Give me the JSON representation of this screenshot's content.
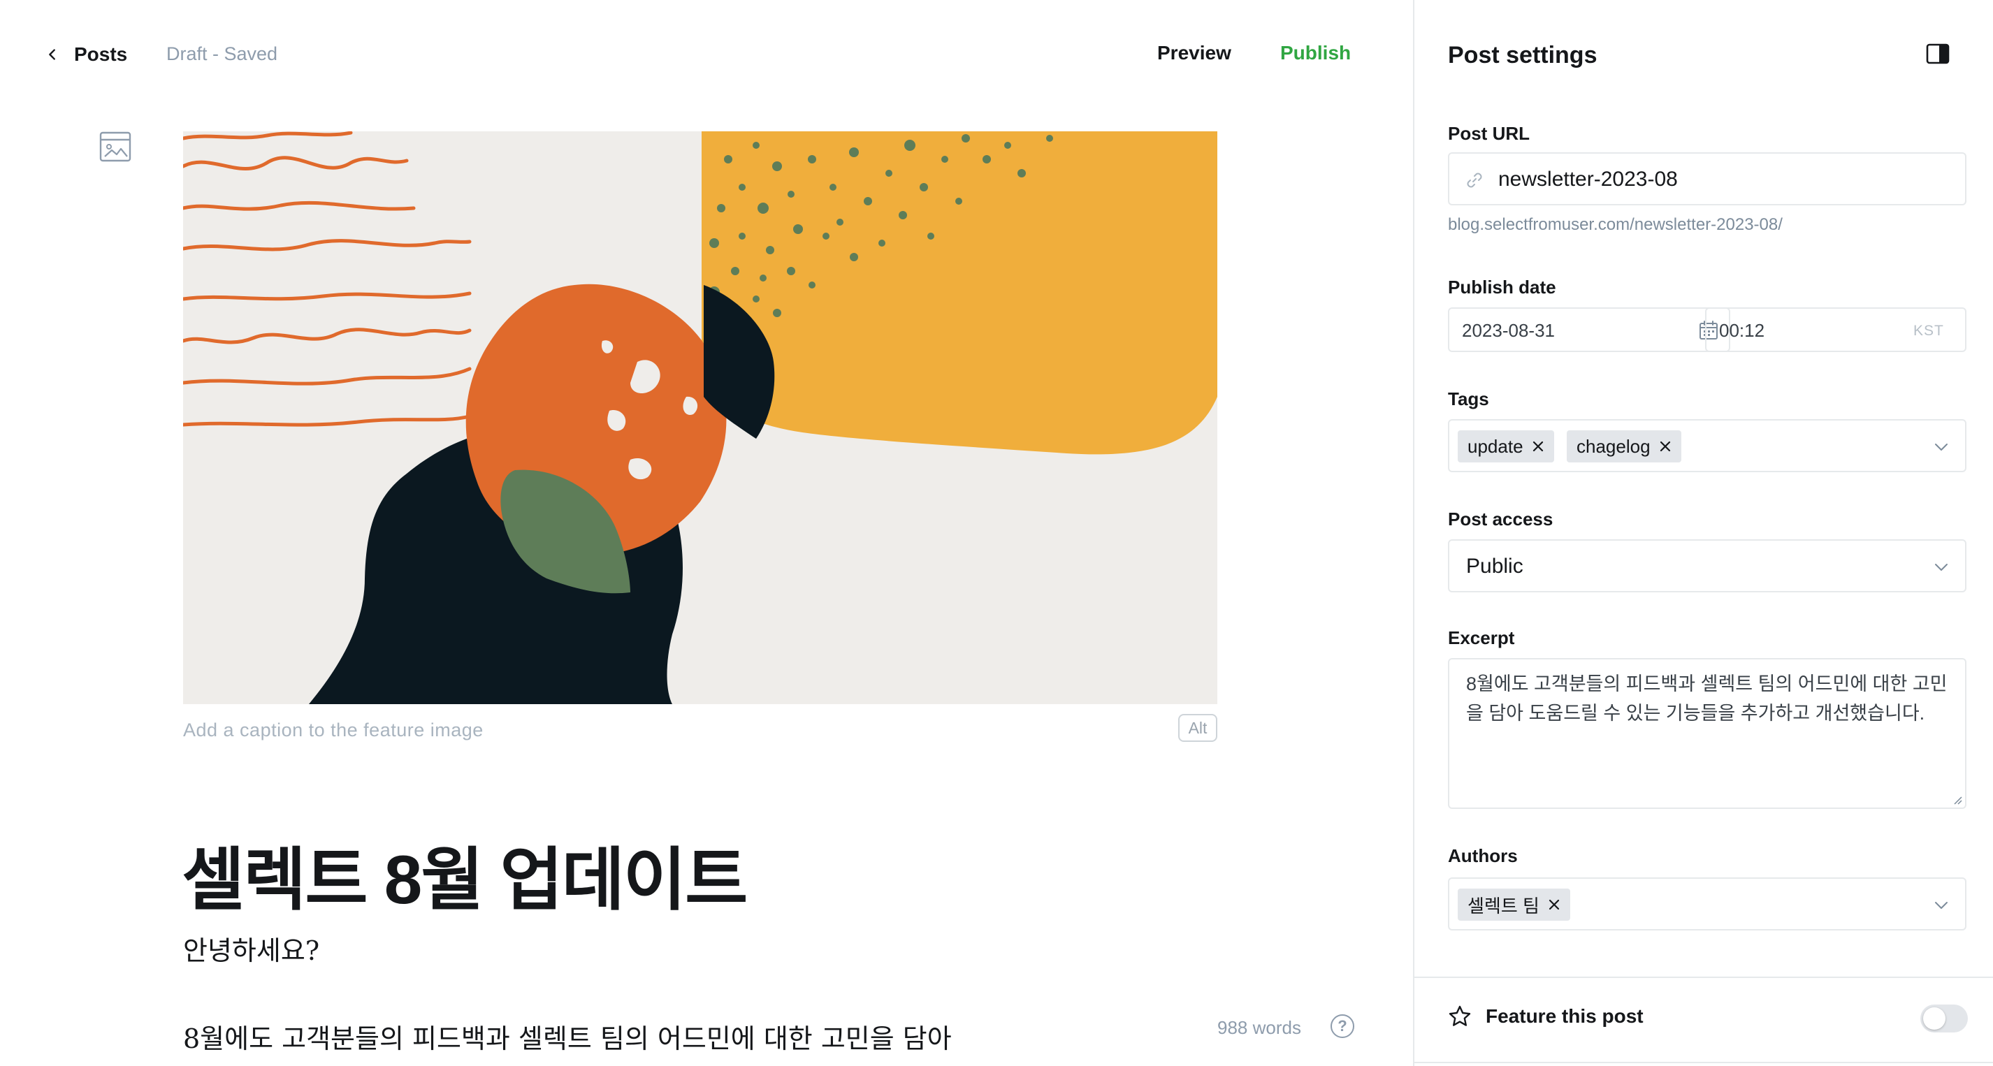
{
  "editor": {
    "back_label": "Posts",
    "status": "Draft - Saved",
    "preview_label": "Preview",
    "publish_label": "Publish",
    "feature_image_caption_placeholder": "Add a caption to the feature image",
    "alt_label": "Alt",
    "title": "셀렉트 8월 업데이트",
    "paragraphs": [
      "안녕하세요?",
      "8월에도 고객분들의 피드백과 셀렉트 팀의 어드민에 대한 고민을 담아"
    ],
    "word_count": "988 words",
    "help_symbol": "?"
  },
  "settings": {
    "title": "Post settings",
    "post_url": {
      "label": "Post URL",
      "value": "newsletter-2023-08",
      "full_url": "blog.selectfromuser.com/newsletter-2023-08/"
    },
    "publish_date": {
      "label": "Publish date",
      "date": "2023-08-31",
      "time": "00:12",
      "timezone": "KST"
    },
    "tags": {
      "label": "Tags",
      "items": [
        "update",
        "chagelog"
      ]
    },
    "post_access": {
      "label": "Post access",
      "value": "Public"
    },
    "excerpt": {
      "label": "Excerpt",
      "value": "8월에도 고객분들의 피드백과 셀렉트 팀의 어드민에 대한 고민을 담아 도움드릴 수 있는 기능들을 추가하고 개선했습니다."
    },
    "authors": {
      "label": "Authors",
      "items": [
        "셀렉트 팀"
      ]
    },
    "feature_post": {
      "label": "Feature this post",
      "enabled": false
    }
  },
  "colors": {
    "publish_green": "#30a642",
    "art_orange": "#e06a2c",
    "art_yellow": "#f0ae3c",
    "art_navy": "#0b1820",
    "art_green": "#5e7d58",
    "art_background": "#efedea"
  }
}
